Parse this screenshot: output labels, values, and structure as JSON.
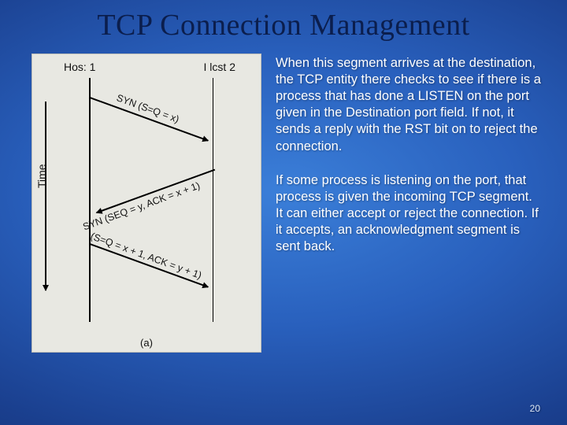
{
  "title": "TCP Connection Management",
  "diagram": {
    "host1": "Hos: 1",
    "host2": "I lcst 2",
    "time_axis": "Time",
    "msg1": "SYN (S=Q = x)",
    "msg2": "SYN (SEQ = y, ACK = x + 1)",
    "msg3": "(S=Q = x + 1, ACK = y + 1)",
    "caption": "(a)"
  },
  "paragraphs": {
    "p1": "When this segment arrives at the destination, the TCP entity there checks to see if there is a process that has done a LISTEN on the port given in the Destination port field. If not, it sends a reply with the RST bit on to reject the connection.",
    "p2": "If some process is listening on the port, that process is given the incoming TCP segment. It can either accept or reject the connection. If it accepts, an acknowledgment segment is sent back."
  },
  "page_number": "20"
}
